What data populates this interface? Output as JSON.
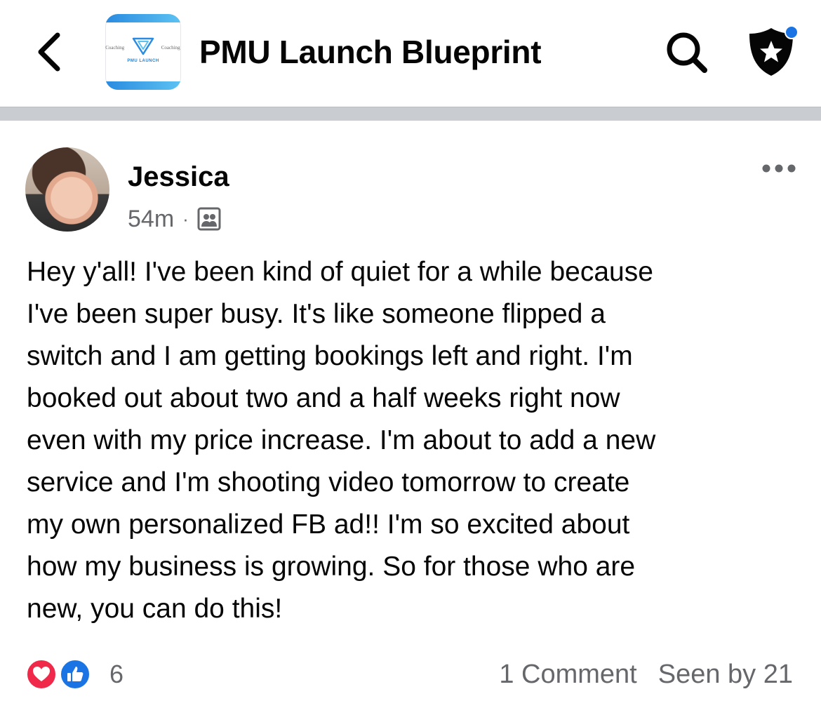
{
  "header": {
    "group_title": "PMU Launch Blueprint",
    "logo": {
      "left_text": "g Coaching",
      "right_text": "Coaching C",
      "word": "PMU LAUNCH",
      "accent_color": "#2a8be0"
    },
    "icons": {
      "back": "chevron-left-icon",
      "search": "search-icon",
      "admin": "shield-star-icon"
    },
    "notification_dot_color": "#1b74e4"
  },
  "post": {
    "author": "Jessica",
    "time": "54m",
    "separator": "·",
    "audience_icon": "group-members-icon",
    "body": "Hey y'all! I've been kind of quiet for a while because\nI've been super busy. It's like someone flipped a\nswitch and I am getting bookings left and right. I'm\nbooked out about two and a half weeks right now\neven with my price increase. I'm about to add a new\nservice and I'm shooting video tomorrow to create\nmy own personalized FB ad!!  I'm so excited about\nhow my business is growing. So for those who are\nnew, you can do this!",
    "reactions": {
      "types": [
        "love",
        "like"
      ],
      "count": "6",
      "love_color": "#f0284a",
      "like_color": "#1b74e4"
    },
    "comments_label": "1 Comment",
    "seen_label": "Seen by 21"
  }
}
